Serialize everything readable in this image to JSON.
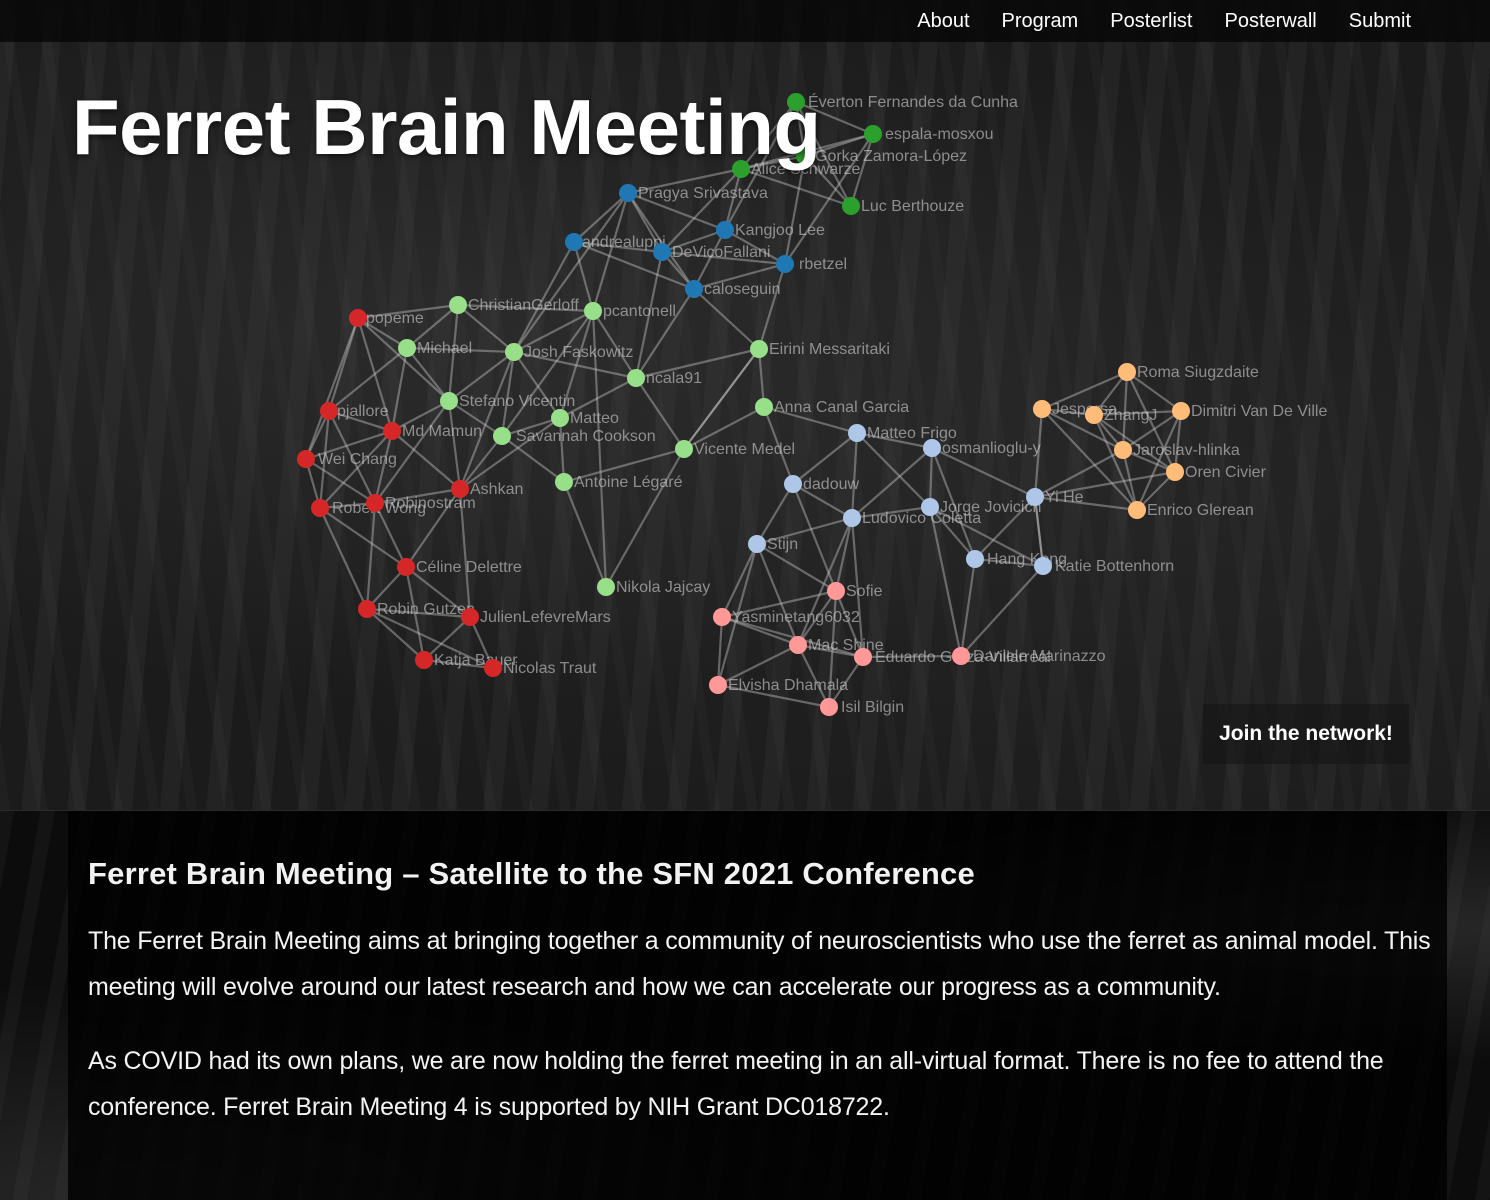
{
  "nav": {
    "items": [
      "About",
      "Program",
      "Posterlist",
      "Posterwall",
      "Submit"
    ]
  },
  "hero": {
    "title": "Ferret Brain Meeting",
    "join_label": "Join the network!"
  },
  "colors": {
    "green": "#2ca02c",
    "blue": "#1f77b4",
    "lightgreen": "#98df8a",
    "red": "#d62728",
    "lightblue": "#aec7e8",
    "orange": "#ffbb78",
    "pink": "#ff9896"
  },
  "network": {
    "labels": [
      "Éverton Fernandes da Cunha",
      "espala-mosxou",
      "Gorka Zamora-López",
      "Alice Schwarze",
      "Luc Berthouze",
      "Pragya Srivastava",
      "andrealuppi",
      "Kangjoo Lee",
      "DeVicoFallani",
      "rbetzel",
      "caloseguin",
      "popeme",
      "ChristianGerloff",
      "pcantonell",
      "Michael",
      "Josh Faskowitz",
      "Eirini Messaritaki",
      "ncala91",
      "Stefano Vicentin",
      "Matteo",
      "pjallore",
      "Md Mamun",
      "Savannah Cookson",
      "Anna Canal Garcia",
      "Matteo Frigo",
      "Wei Chang",
      "Vicente Medel",
      "osmanlioglu-y",
      "Ashkan",
      "Antoine Légaré",
      "dadouw",
      "Robert Wong",
      "Robinostram",
      "Jorge Jovicich",
      "Ludovico Coletta",
      "Stijn",
      "Céline Delettre",
      "Hang Kong",
      "Katie Bottenhorn",
      "Nikola Jajcay",
      "Sofie",
      "Robin Gutzen",
      "JulienLefevreMars",
      "Yasminetang6032",
      "Mac Shine",
      "Katja Bauer",
      "Nicolas Traut",
      "Eduardo Garza-Villarreal",
      "Daniele Marinazzo",
      "Elvisha Dhamala",
      "Isil Bilgin",
      "Roma Siugzdaite",
      "Jespersa",
      "ZhangJ",
      "Dimitri Van De Ville",
      "Jaroslav-hlinka",
      "Oren Civier",
      "Yi He",
      "Enrico Glerean"
    ]
  },
  "content": {
    "heading": "Ferret Brain Meeting – Satellite to the SFN 2021 Conference",
    "p1": "The Ferret Brain Meeting aims at bringing together a community of neuroscientists who use the ferret as animal model. This meeting will evolve around our latest research and how we can accelerate our progress as a community.",
    "p2": "As COVID had its own plans, we are now holding the ferret meeting in an all-virtual format. There is no fee to attend the conference. Ferret Brain Meeting 4 is supported by NIH Grant DC018722."
  }
}
